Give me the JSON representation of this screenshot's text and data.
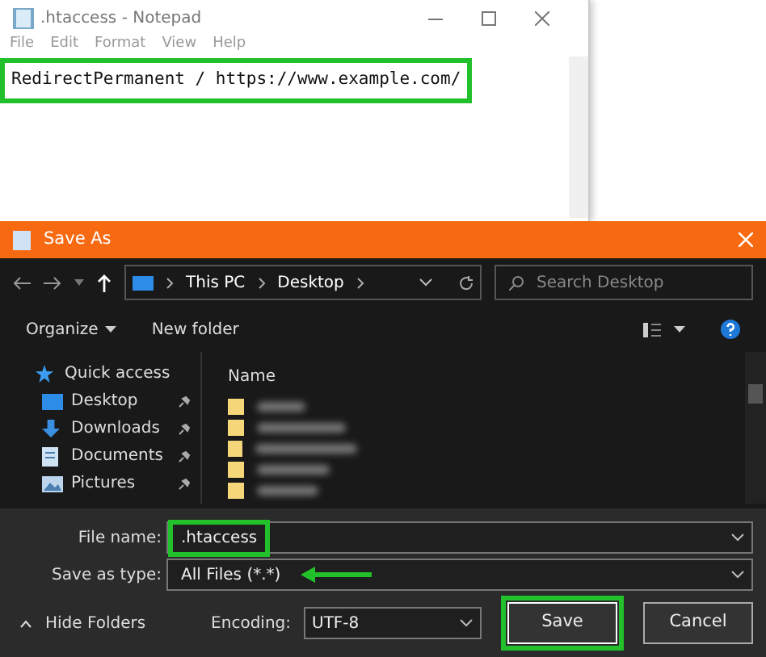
{
  "notepad": {
    "title": ".htaccess - Notepad",
    "menu": [
      "File",
      "Edit",
      "Format",
      "View",
      "Help"
    ],
    "content": "RedirectPermanent / https://www.example.com/",
    "highlighted": true
  },
  "dialog": {
    "title": "Save As",
    "breadcrumb": [
      "This PC",
      "Desktop"
    ],
    "search": {
      "placeholder": "Search Desktop"
    },
    "toolbar": [
      "Organize",
      "New folder"
    ],
    "column": "Name",
    "sidebar": [
      {
        "label": "Quick access",
        "kind": "star"
      },
      {
        "label": "Desktop",
        "kind": "desktop",
        "pinned": true
      },
      {
        "label": "Downloads",
        "kind": "download",
        "pinned": true
      },
      {
        "label": "Documents",
        "kind": "document",
        "pinned": true
      },
      {
        "label": "Pictures",
        "kind": "picture",
        "pinned": true
      }
    ],
    "file_name": {
      "label": "File name:",
      "value": ".htaccess",
      "highlighted": true
    },
    "save_type": {
      "label": "Save as type:",
      "value": "All Files  (*.*)",
      "arrow": true
    },
    "hide_folders": "Hide Folders",
    "encoding": {
      "label": "Encoding:",
      "value": "UTF-8"
    },
    "buttons": [
      {
        "label": "Save",
        "highlighted": true
      },
      {
        "label": "Cancel",
        "highlighted": false
      }
    ]
  }
}
